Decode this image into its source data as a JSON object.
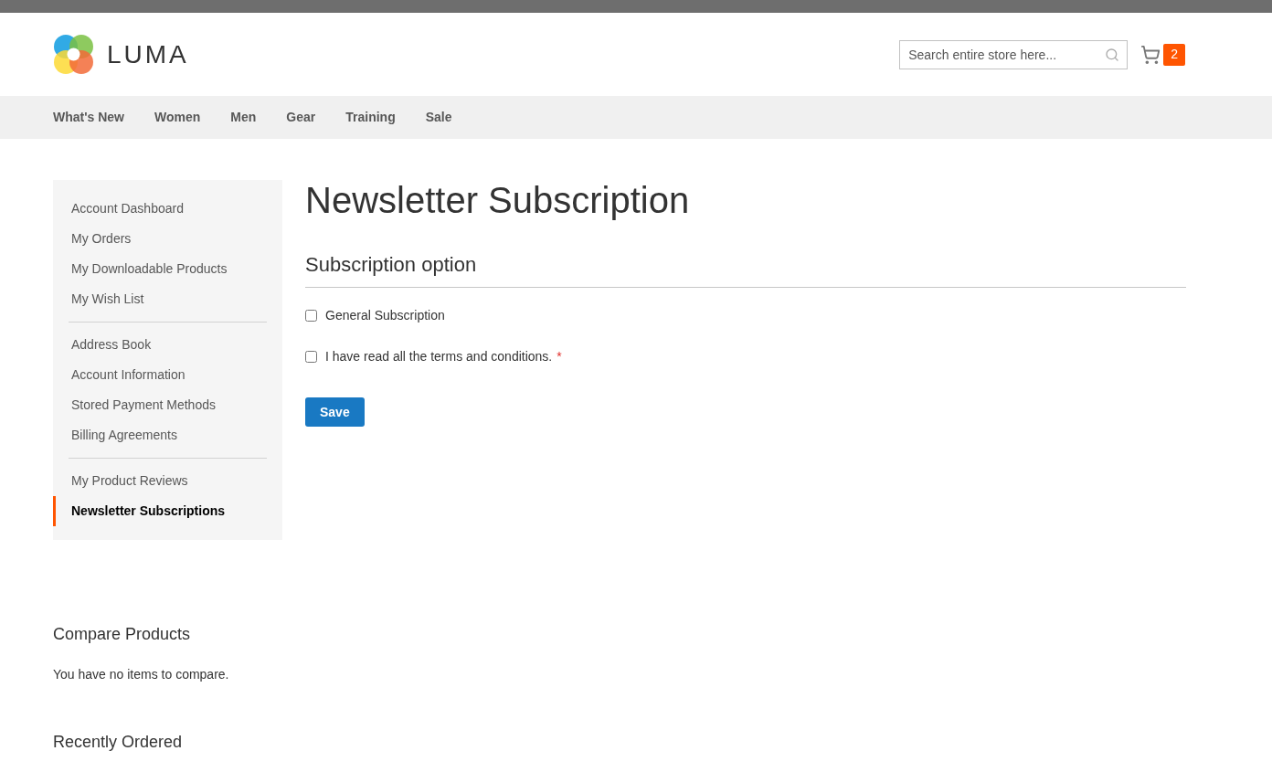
{
  "header": {
    "logo_text": "LUMA",
    "search": {
      "placeholder": "Search entire store here..."
    },
    "cart_count": "2"
  },
  "nav": [
    {
      "label": "What's New"
    },
    {
      "label": "Women"
    },
    {
      "label": "Men"
    },
    {
      "label": "Gear"
    },
    {
      "label": "Training"
    },
    {
      "label": "Sale"
    }
  ],
  "sidebar": {
    "groups": [
      {
        "items": [
          {
            "label": "Account Dashboard",
            "selected": false
          },
          {
            "label": "My Orders",
            "selected": false
          },
          {
            "label": "My Downloadable Products",
            "selected": false
          },
          {
            "label": "My Wish List",
            "selected": false
          }
        ]
      },
      {
        "items": [
          {
            "label": "Address Book",
            "selected": false
          },
          {
            "label": "Account Information",
            "selected": false
          },
          {
            "label": "Stored Payment Methods",
            "selected": false
          },
          {
            "label": "Billing Agreements",
            "selected": false
          }
        ]
      },
      {
        "items": [
          {
            "label": "My Product Reviews",
            "selected": false
          },
          {
            "label": "Newsletter Subscriptions",
            "selected": true
          }
        ]
      }
    ]
  },
  "page_title": "Newsletter Subscription",
  "section_title": "Subscription option",
  "options": [
    {
      "label": "General Subscription",
      "checked": false
    },
    {
      "label": "I have read all the terms and conditions.",
      "checked": false,
      "required_mark": "*"
    }
  ],
  "save_button": "Save",
  "compare": {
    "title": "Compare Products",
    "message": "You have no items to compare."
  },
  "recently_ordered": {
    "title": "Recently Ordered"
  }
}
